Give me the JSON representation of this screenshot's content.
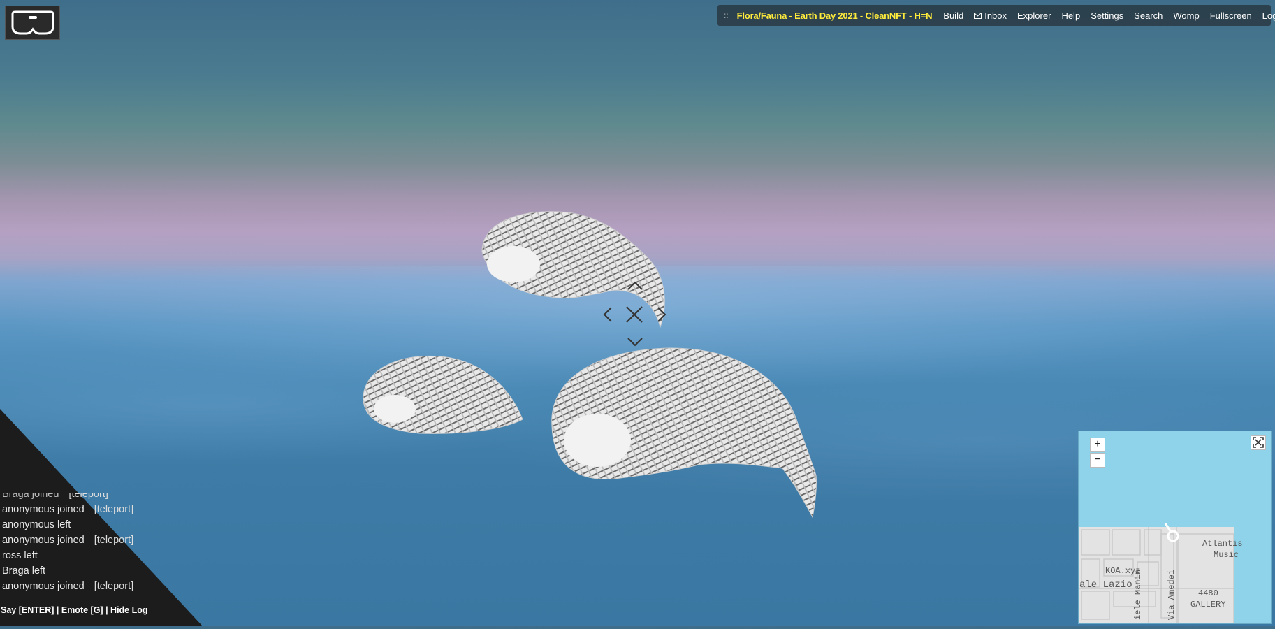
{
  "topbar": {
    "grip": "::",
    "world_name": "Flora/Fauna - Earth Day 2021 - CleanNFT - H=N",
    "items": [
      "Build",
      "Inbox",
      "Explorer",
      "Help",
      "Settings",
      "Search",
      "Womp",
      "Fullscreen",
      "Log out"
    ]
  },
  "chat": {
    "lines": [
      {
        "text": "Braga joined",
        "action": "[teleport]"
      },
      {
        "text": "anonymous joined",
        "action": "[teleport]"
      },
      {
        "text": "anonymous left",
        "action": ""
      },
      {
        "text": "anonymous joined",
        "action": "[teleport]"
      },
      {
        "text": "ross left",
        "action": ""
      },
      {
        "text": "Braga left",
        "action": ""
      },
      {
        "text": "anonymous joined",
        "action": "[teleport]"
      }
    ],
    "say": "Say [ENTER]",
    "emote": "Emote [G]",
    "hide_log": "Hide Log",
    "sep": " | "
  },
  "minimap": {
    "zoom_in": "+",
    "zoom_out": "−",
    "labels": [
      "Atlantis",
      "Music",
      "KOA.xyz",
      "4480",
      "GALLERY",
      "ale Lazio",
      "iele Manin",
      "Via Amedei"
    ]
  },
  "icons": {
    "logo": "vr-headset-icon",
    "inbox": "envelope-icon",
    "fullscreen": "expand-icon"
  },
  "colors": {
    "world_name": "#ffeb3b",
    "menu_bg": "#283741",
    "minimap_water": "#8fd3ea",
    "minimap_land": "#e3e3e3"
  }
}
